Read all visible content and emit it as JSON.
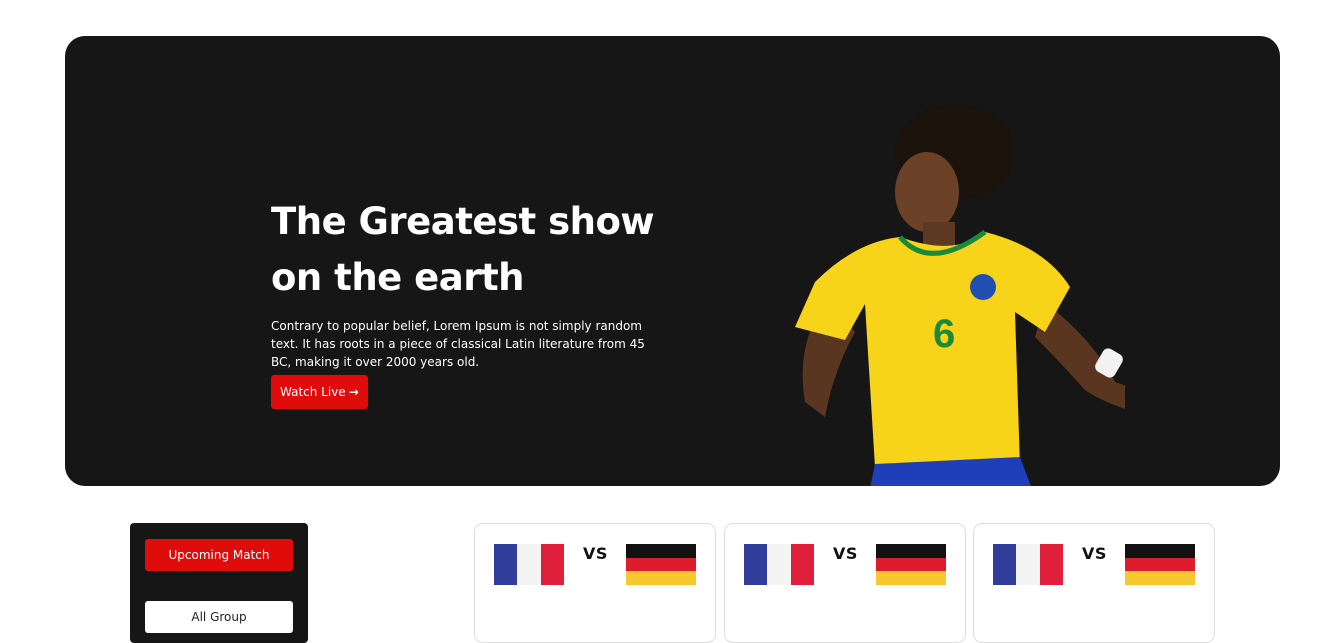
{
  "hero": {
    "title": "The Greatest show on the earth",
    "description": "Contrary to popular belief, Lorem Ipsum is not simply random text. It has roots in a piece of classical Latin literature from 45 BC, making it over 2000 years old.",
    "cta_label": "Watch Live",
    "cta_icon": "arrow-right-icon",
    "background_color": "#161616",
    "accent_color": "#e00b0b"
  },
  "sidebar": {
    "upcoming_label": "Upcoming Match",
    "all_group_label": "All Group"
  },
  "matches": [
    {
      "team_a": "france",
      "team_b": "germany",
      "vs_label": "VS"
    },
    {
      "team_a": "france",
      "team_b": "germany",
      "vs_label": "VS"
    },
    {
      "team_a": "france",
      "team_b": "germany",
      "vs_label": "VS"
    }
  ]
}
